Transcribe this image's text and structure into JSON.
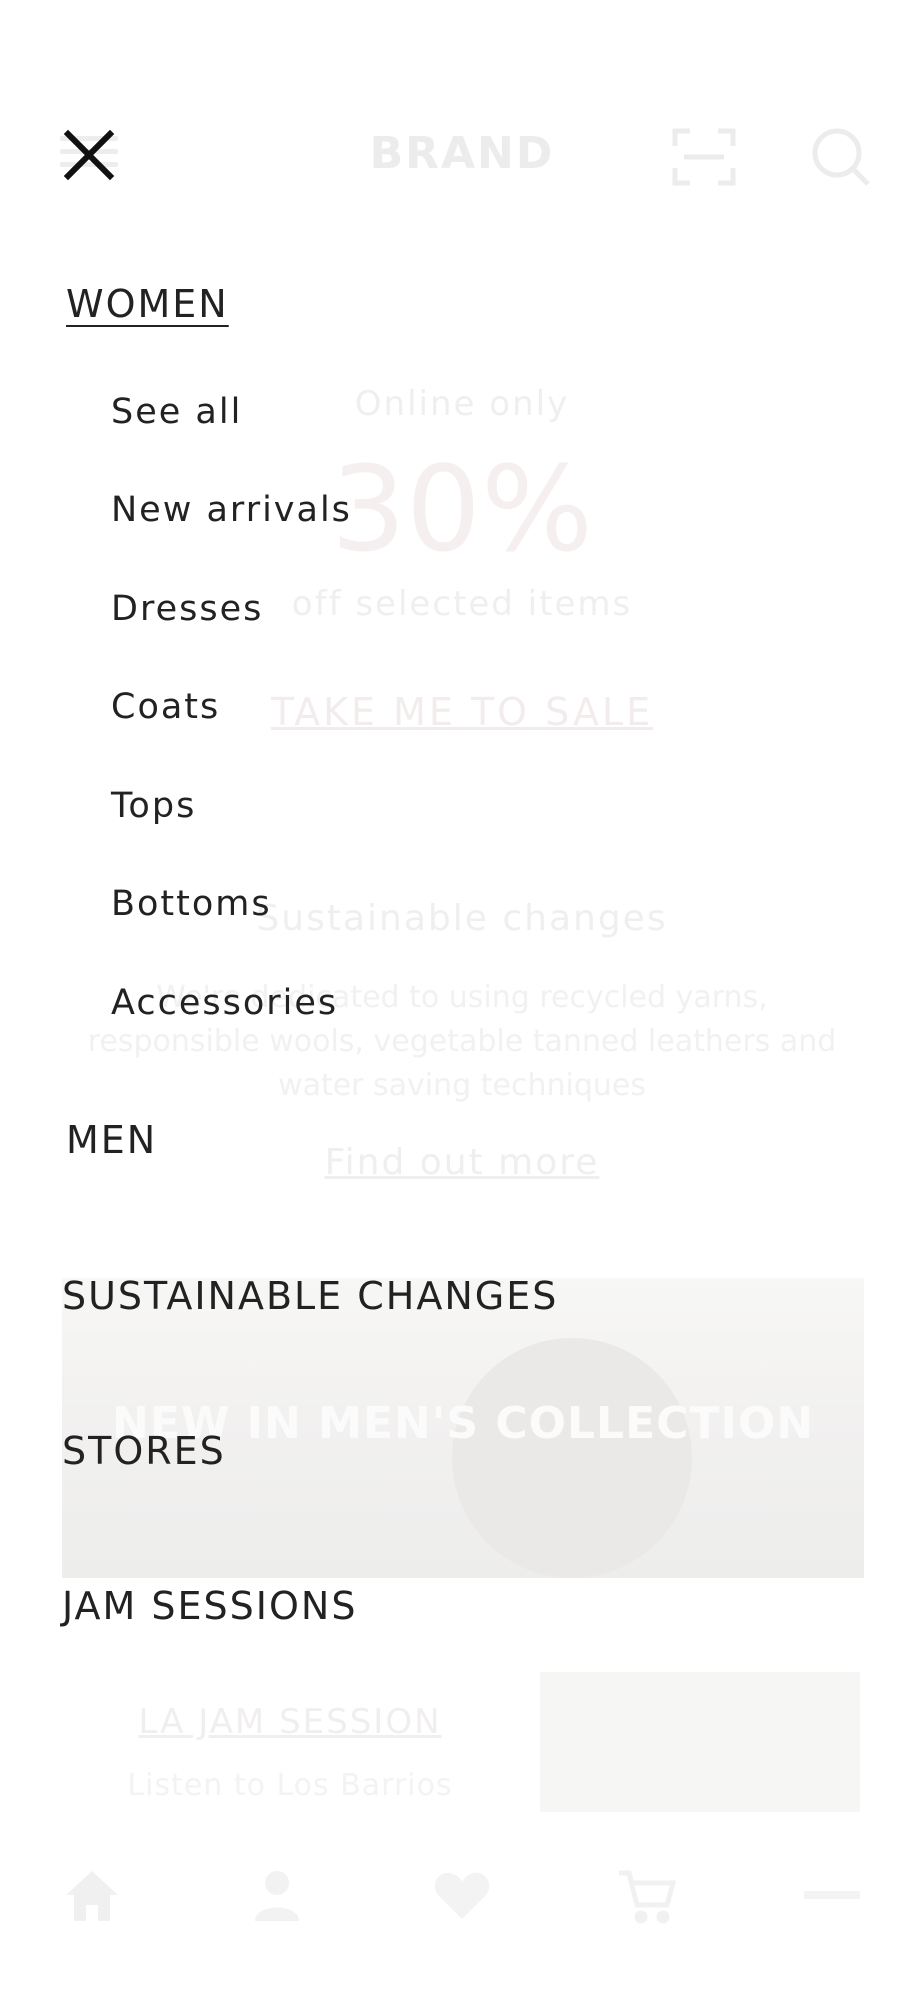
{
  "background": {
    "brand": "BRAND",
    "promo": {
      "online_only": "Online only",
      "percent": "30%",
      "off_text": "off selected items",
      "sale_link": "TAKE ME TO SALE"
    },
    "sustain": {
      "title": "Sustainable changes",
      "body": "We're dedicated to using recycled yarns, responsible wools, vegetable tanned leathers and water saving techniques",
      "link": "Find out more"
    },
    "banner_title": "NEW IN MEN'S COLLECTION",
    "jam": {
      "link": "LA JAM SESSION",
      "subtitle": "Listen to Los Barrios"
    },
    "tab_icons": [
      "home-icon",
      "account-icon",
      "heart-icon",
      "cart-icon",
      "more-icon"
    ]
  },
  "menu": {
    "close_icon": "close-icon",
    "women": {
      "label": "WOMEN",
      "items": [
        "See all",
        "New arrivals",
        "Dresses",
        "Coats",
        "Tops",
        "Bottoms",
        "Accessories"
      ]
    },
    "men": "MEN",
    "sustainable": "SUSTAINABLE CHANGES",
    "stores": "STORES",
    "jam_sessions": "JAM SESSIONS"
  },
  "colors": {
    "text": "#222222",
    "overlay_faded": "#ededed"
  }
}
